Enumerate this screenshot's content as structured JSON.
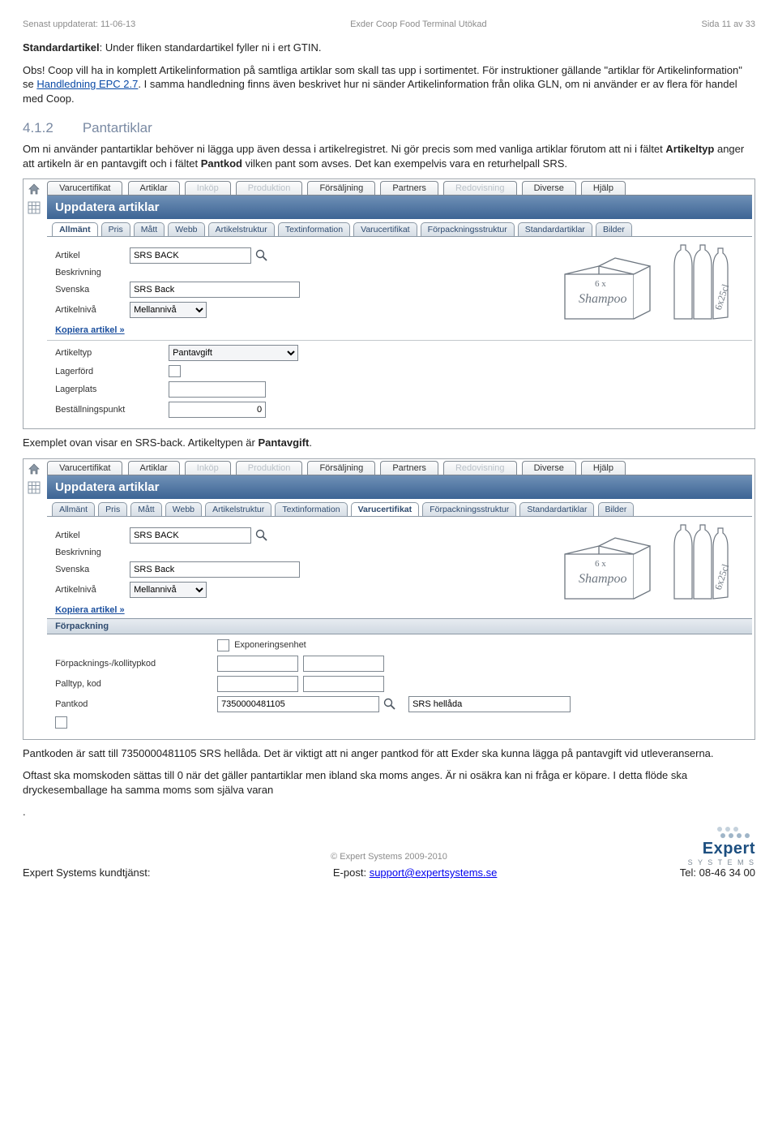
{
  "header": {
    "updated_label": "Senast uppdaterat: 11-06-13",
    "title": "Exder Coop Food Terminal Utökad",
    "page": "Sida 11 av 33"
  },
  "body": {
    "std_label": "Standardartikel",
    "std_text": ": Under fliken standardartikel fyller ni i ert GTIN.",
    "obs1a": "Obs! Coop vill ha in komplett Artikelinformation på samtliga artiklar som skall tas upp i sortimentet. För instruktioner gällande \"artiklar för Artikelinformation\" se ",
    "link": "Handledning EPC 2.7",
    "obs1b": ". I samma handledning finns även beskrivet hur ni sänder Artikelinformation från olika GLN, om ni använder er av flera för handel med Coop.",
    "sec_num": "4.1.2",
    "sec_title": "Pantartiklar",
    "pant_text_a": "Om ni använder pantartiklar behöver ni lägga upp även dessa i artikelregistret. Ni gör precis som med vanliga artiklar förutom att ni i fältet ",
    "pant_bold1": "Artikeltyp",
    "pant_text_b": " anger att artikeln är en pantavgift och i fältet ",
    "pant_bold2": "Pantkod",
    "pant_text_c": " vilken pant som avses. Det kan exempelvis vara en returhelpall SRS.",
    "caption1_a": "Exemplet ovan visar en SRS-back. Artikeltypen är ",
    "caption1_b": "Pantavgift",
    "caption1_c": ".",
    "caption2": "Pantkoden är satt till 7350000481105 SRS hellåda. Det är viktigt att ni anger pantkod för att Exder ska kunna lägga på pantavgift vid utleveranserna.",
    "caption3": "Oftast ska momskoden sättas till 0 när det gäller pantartiklar men ibland ska moms anges. Är ni osäkra kan ni fråga er köpare. I detta flöde ska dryckesemballage ha samma moms som själva varan",
    "caption3_dot": "."
  },
  "shot": {
    "topnav": [
      "Varucertifikat",
      "Artiklar",
      "Inköp",
      "Produktion",
      "Försäljning",
      "Partners",
      "Redovisning",
      "Diverse",
      "Hjälp"
    ],
    "topnav_disabled": [
      false,
      false,
      true,
      true,
      false,
      false,
      true,
      false,
      false
    ],
    "title": "Uppdatera artiklar",
    "subtabs": [
      "Allmänt",
      "Pris",
      "Mått",
      "Webb",
      "Artikelstruktur",
      "Textinformation",
      "Varucertifikat",
      "Förpackningsstruktur",
      "Standardartiklar",
      "Bilder"
    ],
    "labels": {
      "artikel": "Artikel",
      "beskrivning": "Beskrivning",
      "svenska": "Svenska",
      "artikelniva": "Artikelnivå",
      "kopiera": "Kopiera artikel »",
      "artikeltyp": "Artikeltyp",
      "lagerford": "Lagerförd",
      "lagerplats": "Lagerplats",
      "bestallningspunkt": "Beställningspunkt",
      "forpackning": "Förpackning",
      "exponeringsenhet": "Exponeringsenhet",
      "forpkolli": "Förpacknings-/kollitypkod",
      "palltyp": "Palltyp, kod",
      "pantkod": "Pantkod"
    },
    "values": {
      "artikel": "SRS BACK",
      "svenska": "SRS Back",
      "artikelniva": "Mellannivå",
      "artikeltyp": "Pantavgift",
      "bestallningspunkt": "0",
      "pantkod": "7350000481105",
      "pant_name": "SRS hellåda"
    },
    "illus": {
      "box_top": "6 x",
      "box_script": "Shampoo",
      "bottles_side": "6x25cl"
    }
  },
  "footer": {
    "copyright": "© Expert Systems 2009-2010",
    "left_label": "Expert Systems kundtjänst:",
    "mid_label": "E-post: ",
    "email": "support@expertsystems.se",
    "right_label": "Tel: 08-46 34 00",
    "logo_title": "Expert",
    "logo_sub": "S  Y  S  T  E  M  S"
  }
}
